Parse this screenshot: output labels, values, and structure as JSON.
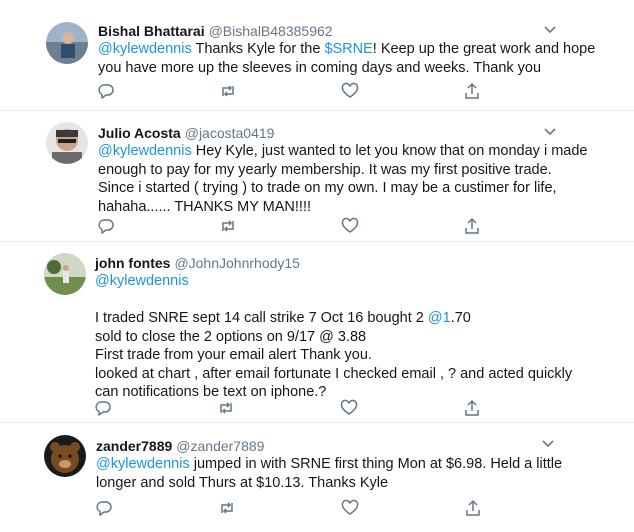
{
  "tweets": [
    {
      "name": "Bishal Bhattarai",
      "handle": "@BishalB48385962",
      "mention": "@kylewdennis",
      "t1": " Thanks Kyle for the ",
      "cashtag": "$SRNE",
      "t2": "! Keep up the great work and hope",
      "line2": "you have more up the sleeves in coming days and weeks. Thank you"
    },
    {
      "name": "Julio Acosta",
      "handle": "@jacosta0419",
      "mention": "@kylewdennis",
      "t1": " Hey Kyle, just wanted to let you know that on monday i made",
      "line2": "enough to pay for my yearly membership.  It was my first positive trade.",
      "line3": "Since i started ( trying ) to trade on my own. I may be a custimer for life,",
      "line4": "hahaha...... THANKS MY MAN!!!!"
    },
    {
      "name": "john fontes",
      "handle": "@JohnJohnrhody15",
      "mention": "@kylewdennis",
      "line3_a": "I traded SNRE  sept 14 call strike 7 Oct 16 bought 2 ",
      "line3_link": "@1",
      "line3_b": ".70",
      "line4": "sold to close the 2 options on 9/17 @ 3.88",
      "line5": "First trade from your email alert Thank you.",
      "line6": "looked at chart ,  after email fortunate I checked email , ?  and acted quickly",
      "line7": "can notifications be text on iphone.?"
    },
    {
      "name": "zander7889",
      "handle": "@zander7889",
      "mention": "@kylewdennis",
      "t1": " jumped in with SRNE first thing Mon at $6.98.  Held a little",
      "line2": "longer and sold Thurs at $10.13. Thanks Kyle"
    }
  ],
  "icons": {
    "reply": "reply-icon",
    "retweet": "retweet-icon",
    "like": "like-icon",
    "share": "share-icon",
    "more": "chevron-down-icon"
  },
  "colors": {
    "link": "#1b95e0",
    "secondary_text": "#657786",
    "icon": "#657786",
    "divider": "#e6ecf0"
  }
}
